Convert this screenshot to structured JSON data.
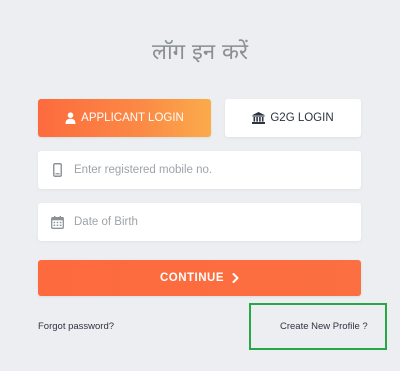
{
  "page": {
    "title": "लॉग इन करें"
  },
  "login_tabs": {
    "applicant_label": "APPLICANT LOGIN",
    "g2g_label": "G2G LOGIN"
  },
  "form": {
    "mobile_placeholder": "Enter registered mobile no.",
    "mobile_value": "",
    "dob_placeholder": "Date of Birth",
    "dob_value": "",
    "continue_label": "CONTINUE"
  },
  "links": {
    "forgot_password": "Forgot password?",
    "create_profile": "Create New Profile ?"
  },
  "icons": {
    "applicant": "user-icon",
    "g2g": "bank-icon",
    "mobile": "mobile-phone-icon",
    "dob": "calendar-icon",
    "continue": "chevron-right-icon"
  },
  "colors": {
    "background": "#eceef1",
    "primary_orange": "#fd6a3e",
    "gradient_end": "#fbab4b",
    "highlight_green": "#28a745",
    "text_dark": "#2d3440",
    "placeholder": "#9ea3a9"
  }
}
